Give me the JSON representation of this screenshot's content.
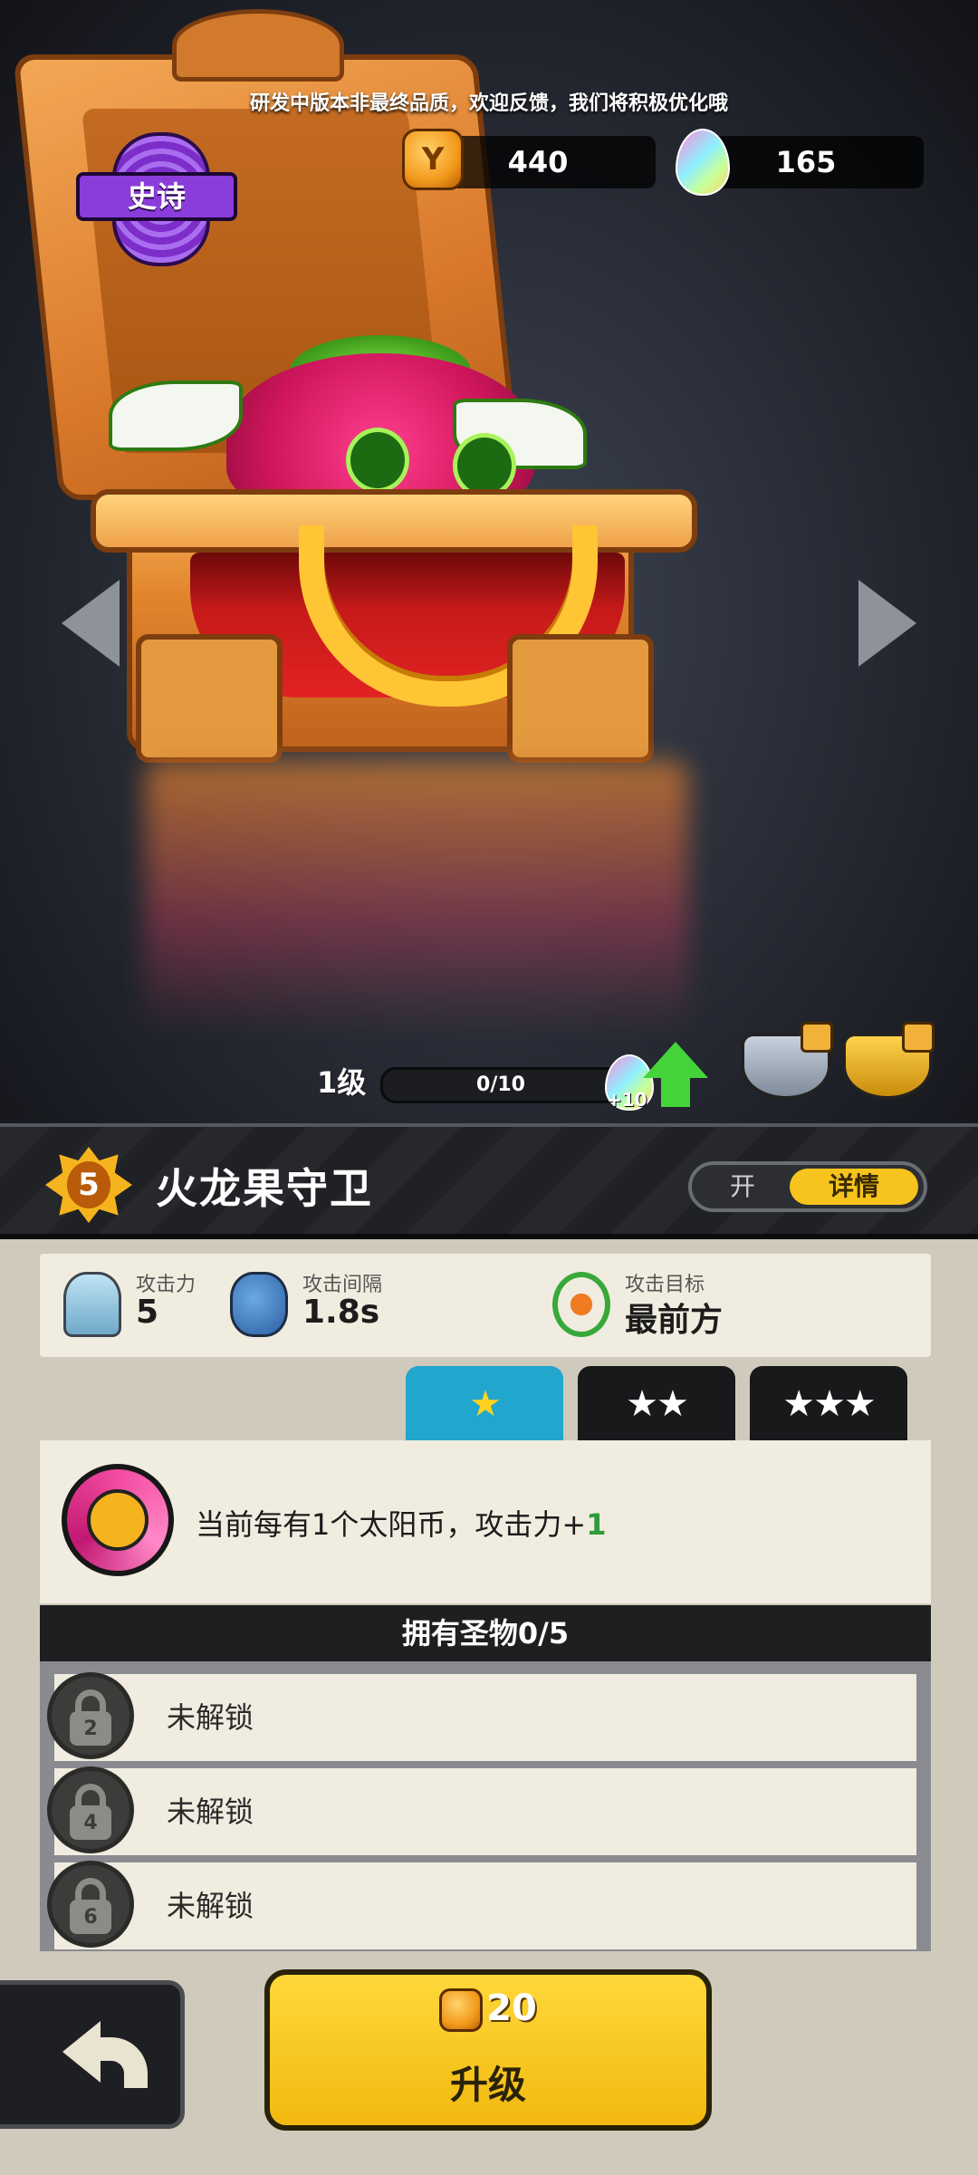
{
  "banner": "研发中版本非最终品质，欢迎反馈，我们将积极优化哦",
  "currency": {
    "coins": "440",
    "gems": "165"
  },
  "rarity": "史诗",
  "level": {
    "label": "1级",
    "xp": "0/10",
    "xp_bonus": "+10",
    "progress": 0
  },
  "plant": {
    "star_level": "5",
    "name": "火龙果守卫"
  },
  "toggle": {
    "off_label": "开",
    "on_label": "详情"
  },
  "stats": [
    {
      "label": "攻击力",
      "value": "5",
      "icon": "sword-icon"
    },
    {
      "label": "攻击间隔",
      "value": "1.8s",
      "icon": "hourglass-cloud-icon"
    },
    {
      "label": "攻击目标",
      "value": "最前方",
      "icon": "crosshair-icon"
    }
  ],
  "tabs": [
    "★",
    "★★",
    "★★★"
  ],
  "skill": {
    "text": "当前每有1个太阳币，攻击力+",
    "bonus": "1"
  },
  "relics": {
    "header": "拥有圣物0/5",
    "items": [
      {
        "level": "2",
        "label": "未解锁"
      },
      {
        "level": "4",
        "label": "未解锁"
      },
      {
        "level": "6",
        "label": "未解锁"
      }
    ]
  },
  "upgrade": {
    "cost": "20",
    "label": "升级"
  },
  "colors": {
    "accent": "#f6c41c",
    "tab_active": "#21a6cd",
    "xp": "#2aa63a",
    "rarity": "#8a3ddb"
  }
}
